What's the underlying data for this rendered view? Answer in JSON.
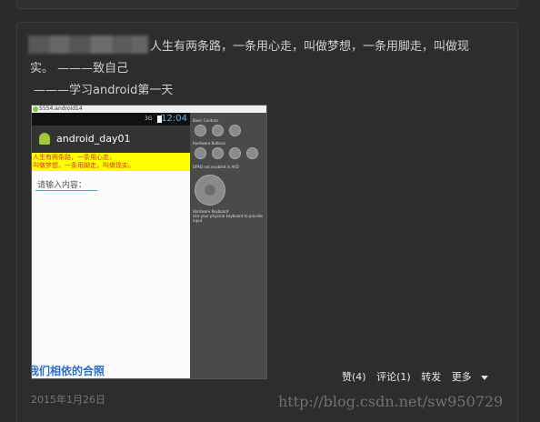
{
  "post": {
    "lines": [
      "人生有两条路，一条用心走，叫做梦想，一条用脚走，叫做现",
      "实。 ———致自己",
      "———学习android第一天"
    ],
    "date": "2015年1月26日"
  },
  "screenshot": {
    "window_title": "5554:android14",
    "status_clock": "12:04",
    "status_signal": "3G",
    "app_name": "android_day01",
    "yellow_text_1": "人生有两条路，一条用心走，",
    "yellow_text_2": "叫做梦想，一条用脚走，叫做现实。",
    "input_hint": "请输入内容：",
    "bottom_text": "我们相依的合照",
    "side_labels": {
      "basic_controls": "Basic Controls",
      "hardware_buttons": "Hardware Buttons",
      "dpad": "DPAD",
      "dpad_note": "not enabled in AVD",
      "hardware_keyboard": "Hardware Keyboard",
      "keyboard_note": "Use your physical keyboard to provide input"
    }
  },
  "actions": {
    "like": "赞(4)",
    "comment": "评论(1)",
    "share": "转发",
    "more": "更多"
  },
  "watermark": "http://blog.csdn.net/sw950729"
}
